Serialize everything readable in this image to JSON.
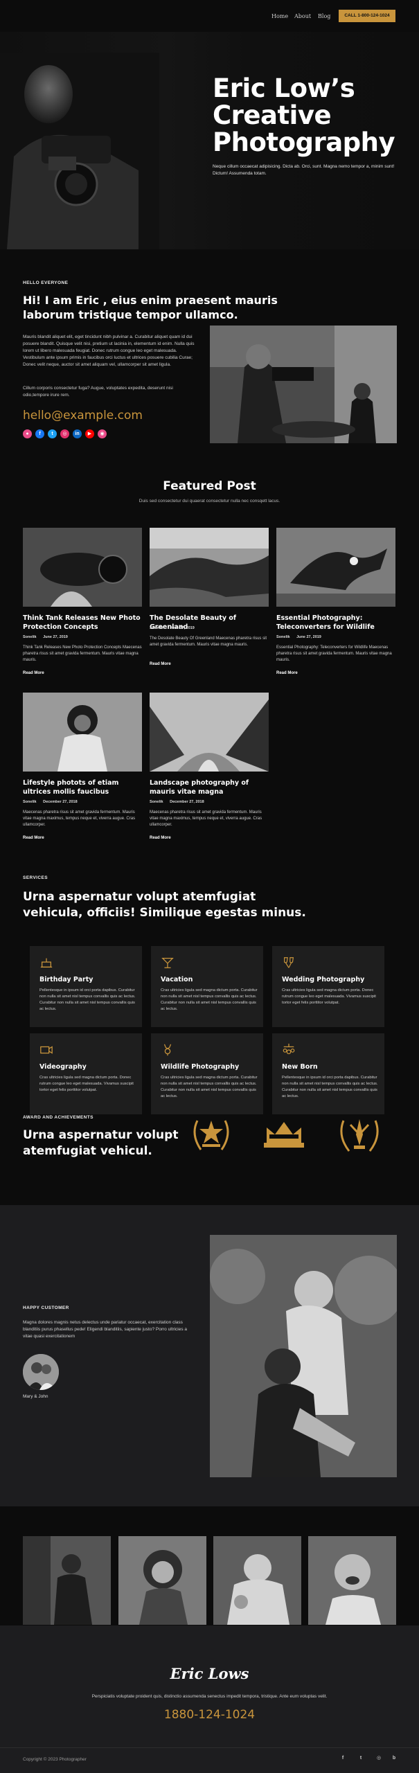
{
  "nav": {
    "links": [
      "Home",
      "About",
      "Blog"
    ],
    "phone_button": "CALL 1-800-124-1024"
  },
  "hero": {
    "title_line1": "Eric Low’s",
    "title_line2": "Creative",
    "title_line3": "Photography",
    "subtitle": "Neque cillum occaecat adipisicing. Dicta ab. Orci, sunt. Magna nemo tempor a, minim sunt! Dictum! Assumenda totam."
  },
  "about": {
    "kicker": "HELLO EVERYONE",
    "title": "Hi! I am Eric , eius enim praesent mauris laborum tristique tempor ullamco.",
    "paragraph1": "Mauris blandit aliquet elit, eget tincidunt nibh pulvinar a. Curabitur aliquet quam id dui posuere blandit. Quisque velit nisi, pretium ut lacinia in, elementum id enim. Nulla quis lorem ut libero malesuada feugiat. Donec rutrum congue leo eget malesuada. Vestibulum ante ipsum primis in faucibus orci luctus et ultrices posuere cubilia Curae; Donec velit neque, auctor sit amet aliquam vel, ullamcorper sit amet ligula.",
    "paragraph2": "Cillum corporis consectetur fuga? Augue, voluptates expedita, deserunt nisi odio,tempore irure rem.",
    "email": "hello@example.com",
    "socials": [
      {
        "icon": "dribbble-icon",
        "glyph": "●",
        "color": "#ea4c89"
      },
      {
        "icon": "facebook-icon",
        "glyph": "f",
        "color": "#1877f2"
      },
      {
        "icon": "twitter-icon",
        "glyph": "t",
        "color": "#1da1f2"
      },
      {
        "icon": "instagram-icon",
        "glyph": "◎",
        "color": "#e1306c"
      },
      {
        "icon": "linkedin-icon",
        "glyph": "in",
        "color": "#0a66c2"
      },
      {
        "icon": "youtube-icon",
        "glyph": "▶",
        "color": "#ff0000"
      },
      {
        "icon": "dribbble-alt-icon",
        "glyph": "◉",
        "color": "#ea4c89"
      }
    ]
  },
  "featured": {
    "title": "Featured Post",
    "subtitle": "Duis sed consectetur dui quaerat consectetur nulla nec consqett lacus.",
    "posts": [
      {
        "title": "Think Tank Releases New Photo Protection Concepts",
        "author": "Sonelik",
        "date": "June 27, 2019",
        "excerpt": "Think Tank Releases New Photo Protection Concepts Maecenas pharetra risus sit amet gravida fermentum. Mauris vitae magna mauris.",
        "more": "Read More"
      },
      {
        "title": "The Desolate Beauty of Greenland",
        "author": "Sonelik",
        "date": "June 27, 2019",
        "excerpt": "The Desolate Beauty Of Greenland Maecenas pharetra risus sit amet gravida fermentum. Mauris vitae magna mauris.",
        "more": "Read More"
      },
      {
        "title": "Essential Photography: Teleconverters for Wildlife",
        "author": "Sonelik",
        "date": "June 27, 2019",
        "excerpt": "Essential Photography: Teleconverters for Wildlife Maecenas pharetra risus sit amet gravida fermentum. Mauris vitae magna mauris.",
        "more": "Read More"
      },
      {
        "title": "Lifestyle photots of etiam ultrices mollis faucibus",
        "author": "Sonelik",
        "date": "December 27, 2018",
        "excerpt": "Maecenas pharetra risus sit amet gravida fermentum. Mauris vitae magna maximus, tempus neque et, viverra augue. Cras ullamcorper.",
        "more": "Read More"
      },
      {
        "title": "Landscape photography of mauris vitae magna",
        "author": "Sonelik",
        "date": "December 27, 2018",
        "excerpt": "Maecenas pharetra risus sit amet gravida fermentum. Mauris vitae magna maximus, tempus neque et, viverra augue. Cras ullamcorper.",
        "more": "Read More"
      }
    ]
  },
  "services": {
    "kicker": "SERVICES",
    "title": "Urna aspernatur volupt atemfugiat vehicula, officiis! Similique egestas minus.",
    "items": [
      {
        "name": "Birthday Party",
        "icon": "cake-icon",
        "text": "Pellentesque in ipsum id orci porta dapibus. Curabitur non nulla sit amet nisl tempus convallis quis ac lectus. Curabitur non nulla sit amet nisl tempus convallis quis ac lectus."
      },
      {
        "name": "Vacation",
        "icon": "cocktail-icon",
        "text": "Cras ultricies ligula sed magna dictum porta. Curabitur non nulla sit amet nisl tempus convallis quis ac lectus. Curabitur non nulla sit amet nisl tempus convallis quis ac lectus."
      },
      {
        "name": "Wedding Photography",
        "icon": "wedding-glasses-icon",
        "text": "Cras ultricies ligula sed magna dictum porta. Donec rutrum congue leo eget malesuada. Vivamus suscipit tortor eget felis porttitor volutpat."
      },
      {
        "name": "Videography",
        "icon": "video-camera-icon",
        "text": "Cras ultricies ligula sed magna dictum porta. Donec rutrum congue leo eget malesuada. Vivamus suscipit tortor eget felis porttitor volutpat."
      },
      {
        "name": "Wildlife Photography",
        "icon": "deer-icon",
        "text": "Cras ultricies ligula sed magna dictum porta. Curabitur non nulla sit amet nisl tempus convallis quis ac lectus. Curabitur non nulla sit amet nisl tempus convallis quis ac lectus."
      },
      {
        "name": "New Born",
        "icon": "baby-mobile-icon",
        "text": "Pellentesque in ipsum id orci porta dapibus. Curabitur non nulla sit amet nisl tempus convallis quis ac lectus. Curabitur non nulla sit amet nisl tempus convallis quis ac lectus."
      }
    ]
  },
  "awards": {
    "kicker": "AWARD AND ACHIEVEMENTS",
    "title": "Urna aspernatur volupt atemfugiat vehicul.",
    "badges": [
      "star-laurel-award-icon",
      "crown-award-icon",
      "trophy-laurel-award-icon"
    ]
  },
  "testimonial": {
    "kicker": "HAPPY CUSTOMER",
    "text": "Magna dolores magnis netus delectus unde pariatur occaecat, exercitation class blanditiis purus phasellus pede! Eligendi blanditiis, sapiente justo? Porro ultricies a vitae quasi exercitationem",
    "name": "Mary & John"
  },
  "footer": {
    "logo": "Eric Lows",
    "text": "Perspiciatis voluptate proident quis, distinctio assumenda senectus impedit tempora, tristique. Ante eum voluptas velit.",
    "phone": "1880-124-1024",
    "copyright": "Copyright © 2023 Photographer",
    "socials": [
      {
        "icon": "facebook-icon",
        "glyph": "f"
      },
      {
        "icon": "twitter-icon",
        "glyph": "t"
      },
      {
        "icon": "instagram-icon",
        "glyph": "◎"
      },
      {
        "icon": "behance-icon",
        "glyph": "b"
      }
    ]
  },
  "colors": {
    "accent": "#c9953c",
    "background": "#0c0c0c",
    "card": "#1e1e1e",
    "footer": "#1d1d1f"
  }
}
